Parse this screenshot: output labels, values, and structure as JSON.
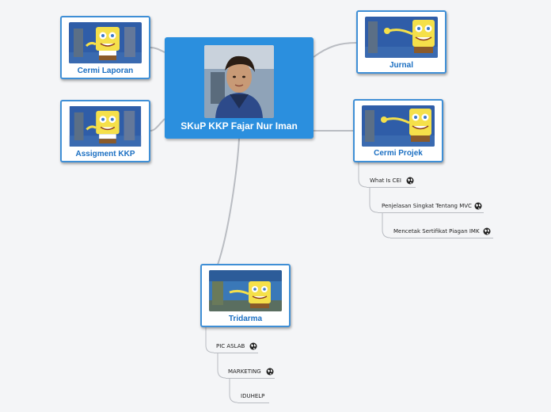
{
  "central": {
    "title": "SKuP KKP Fajar Nur Iman",
    "image": "portrait-photo"
  },
  "topics": [
    {
      "title": "Cermi Laporan",
      "image": "spongebob-thumbnail"
    },
    {
      "title": "Assigment KKP",
      "image": "spongebob-thumbnail"
    },
    {
      "title": "Jurnal",
      "image": "spongebob-thumbnail"
    },
    {
      "title": "Cermi Projek",
      "image": "spongebob-thumbnail"
    },
    {
      "title": "Tridarma",
      "image": "spongebob-thumbnail"
    }
  ],
  "cermi_projek_items": [
    {
      "label": "What Is CEI",
      "icon": "globe-icon"
    },
    {
      "label": "Penjelasan Singkat Tentang MVC",
      "icon": "globe-icon"
    },
    {
      "label": "Mencetak Sertifikat Piagan IMK",
      "icon": "globe-icon"
    }
  ],
  "tridarma_items": [
    {
      "label": "PIC ASLAB",
      "icon": "globe-icon"
    },
    {
      "label": "MARKETING",
      "icon": "globe-icon"
    },
    {
      "label": "IDUHELP",
      "icon": ""
    }
  ],
  "colors": {
    "central_fill": "#2b8fde",
    "topic_border": "#3f8fd6",
    "topic_text": "#1b6fc2",
    "connector": "#b9bcc2"
  }
}
